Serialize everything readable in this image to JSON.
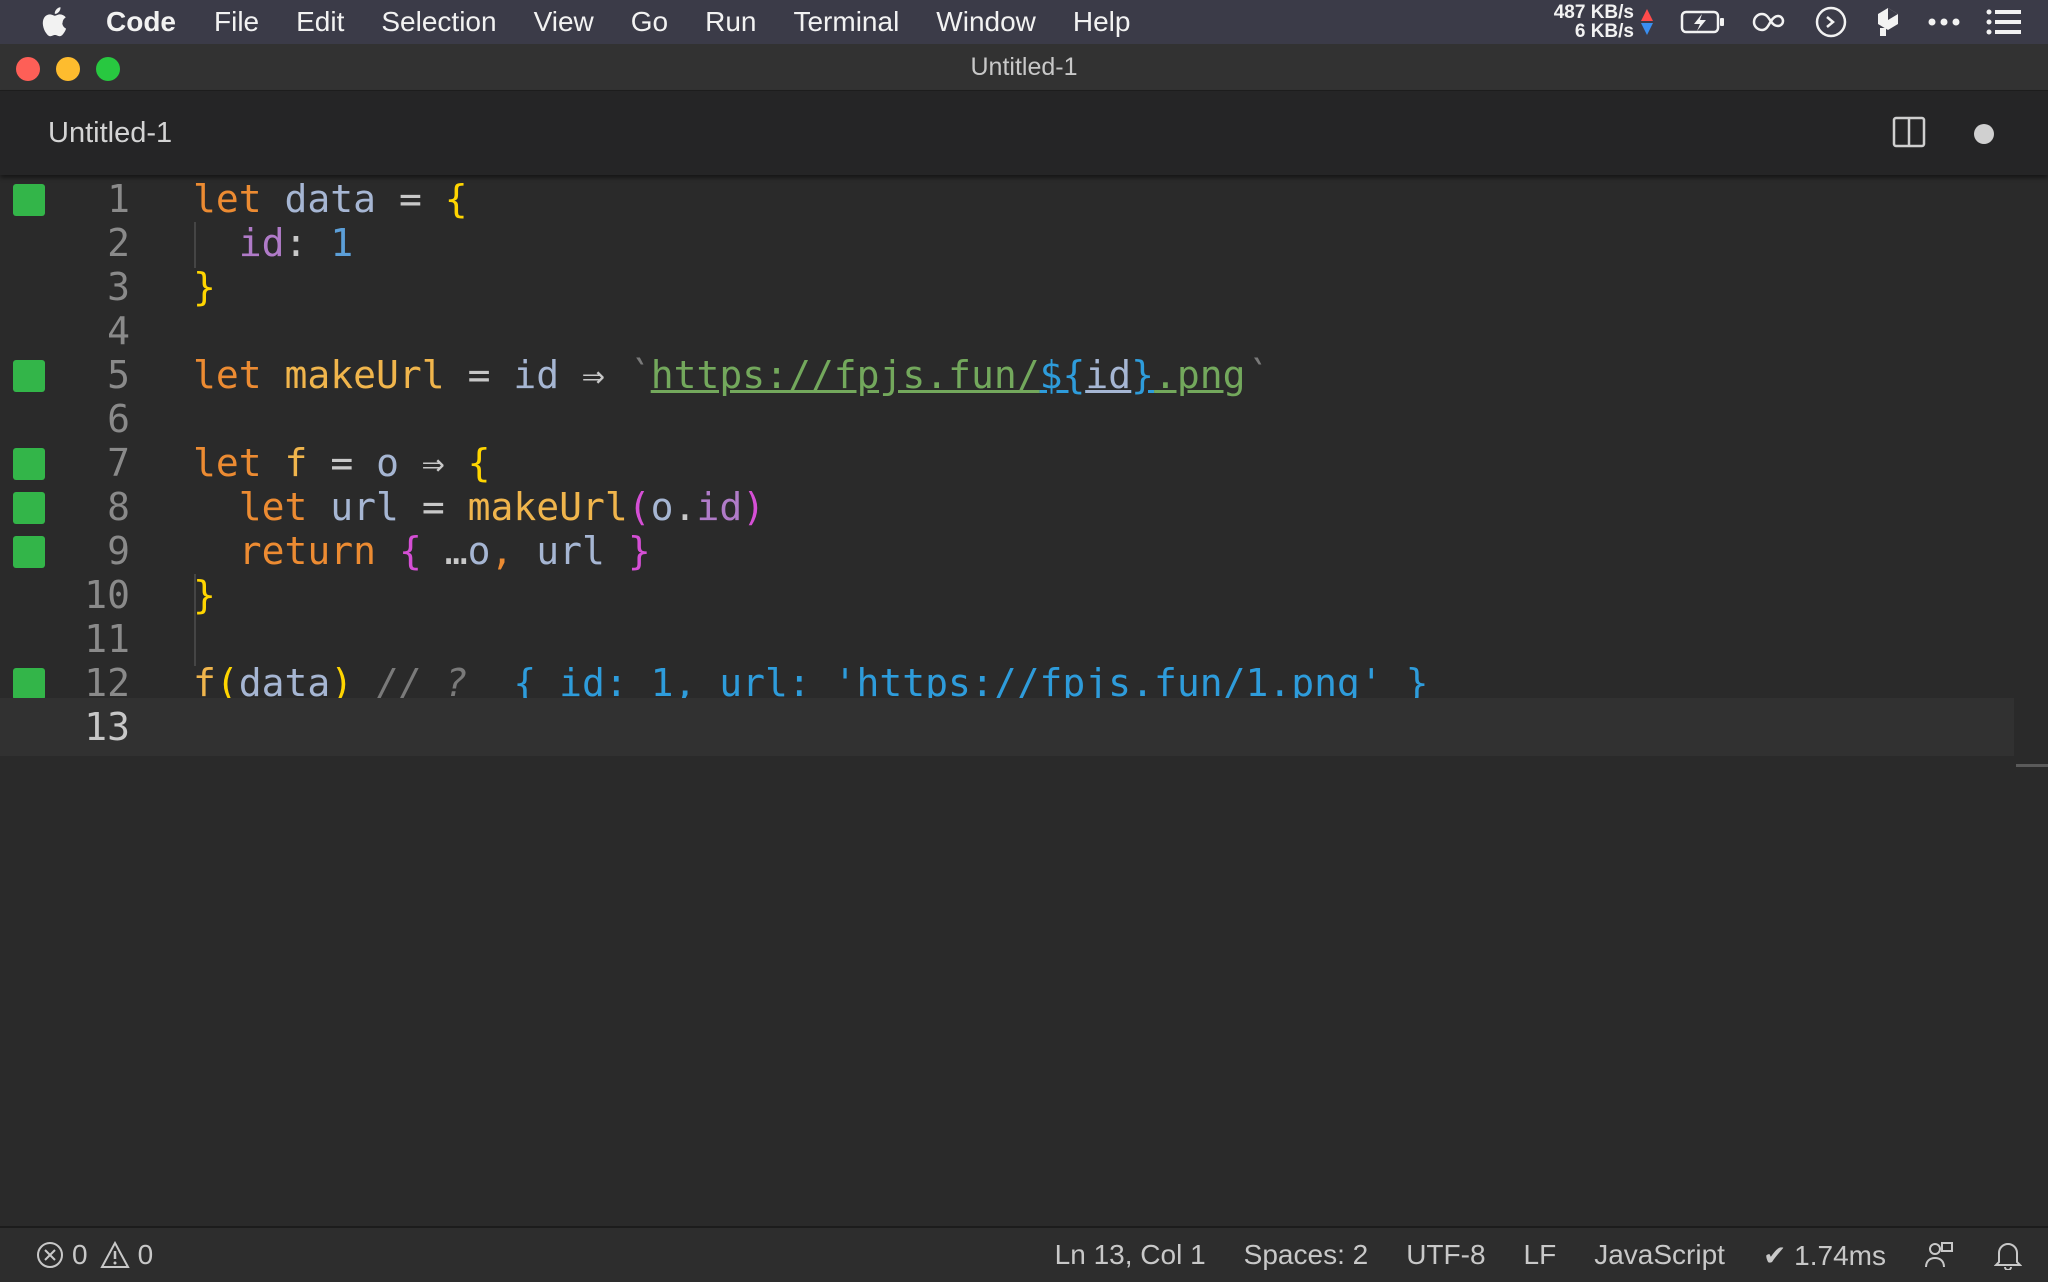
{
  "menubar": {
    "app_name": "Code",
    "items": [
      "File",
      "Edit",
      "Selection",
      "View",
      "Go",
      "Run",
      "Terminal",
      "Window",
      "Help"
    ],
    "net_up": "487 KB/s",
    "net_down": "6 KB/s",
    "icons": [
      "apple-icon",
      "battery-charging-icon",
      "creative-cloud-icon",
      "clock-icon",
      "dropbox-icon",
      "more-icon",
      "list-icon"
    ]
  },
  "window": {
    "title": "Untitled-1"
  },
  "tabs": [
    {
      "label": "Untitled-1",
      "dirty": true
    }
  ],
  "editor": {
    "current_line": 13,
    "lines": [
      {
        "n": "1",
        "covered": true
      },
      {
        "n": "2",
        "covered": false
      },
      {
        "n": "3",
        "covered": false
      },
      {
        "n": "4",
        "covered": false
      },
      {
        "n": "5",
        "covered": true
      },
      {
        "n": "6",
        "covered": false
      },
      {
        "n": "7",
        "covered": true
      },
      {
        "n": "8",
        "covered": true
      },
      {
        "n": "9",
        "covered": true
      },
      {
        "n": "10",
        "covered": false
      },
      {
        "n": "11",
        "covered": false
      },
      {
        "n": "12",
        "covered": true
      },
      {
        "n": "13",
        "covered": false
      }
    ],
    "code": {
      "l1": {
        "kw": "let",
        "name": "data",
        "eq": "=",
        "open": "{"
      },
      "l2": {
        "prop": "id",
        "colon": ":",
        "num": "1"
      },
      "l3": {
        "close": "}"
      },
      "l5": {
        "kw": "let",
        "name": "makeUrl",
        "eq": "=",
        "param": "id",
        "arrow": "⇒",
        "tick_open": "`",
        "str": "https://fpjs.fun/",
        "interp_open": "${",
        "interp_id": "id",
        "interp_close": "}",
        "str_end": ".png",
        "tick_close": "`"
      },
      "l7": {
        "kw": "let",
        "name": "f",
        "eq": "=",
        "param": "o",
        "arrow": "⇒",
        "open": "{"
      },
      "l8": {
        "kw": "let",
        "name": "url",
        "eq": "=",
        "fn": "makeUrl",
        "paren_open": "(",
        "obj": "o",
        "dot": ".",
        "prop": "id",
        "paren_close": ")"
      },
      "l9": {
        "kw": "return",
        "open": "{",
        "spread": "…",
        "obj": "o",
        "comma": ",",
        "name": "url",
        "close": "}"
      },
      "l10": {
        "close": "}"
      },
      "l12": {
        "fn": "f",
        "paren_open": "(",
        "arg": "data",
        "paren_close": ")",
        "comment": "// ?",
        "result": "{ id: 1, url: 'https://fpjs.fun/1.png' }"
      }
    }
  },
  "statusbar": {
    "errors": "0",
    "warnings": "0",
    "position": "Ln 13, Col 1",
    "spaces": "Spaces: 2",
    "encoding": "UTF-8",
    "eol": "LF",
    "language": "JavaScript",
    "timing": "✔ 1.74ms"
  }
}
